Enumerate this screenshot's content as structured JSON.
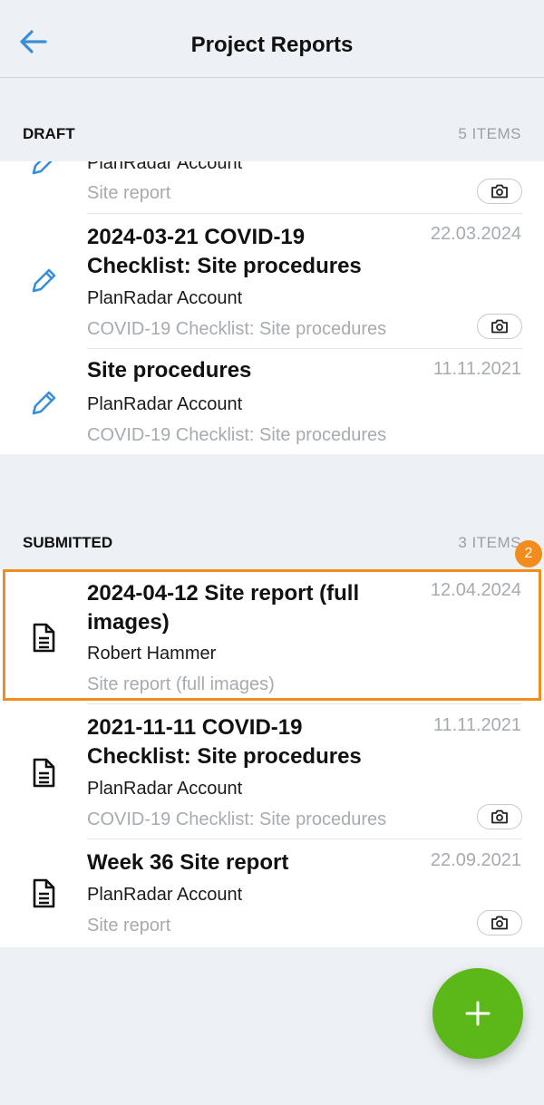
{
  "header": {
    "title": "Project Reports"
  },
  "draft": {
    "label": "DRAFT",
    "count": "5 ITEMS",
    "items": [
      {
        "title": "",
        "owner": "PlanRadar Account",
        "type": "Site report",
        "date": ""
      },
      {
        "title": "2024-03-21 COVID-19 Checklist: Site procedures",
        "owner": "PlanRadar Account",
        "type": "COVID-19 Checklist: Site procedures",
        "date": "22.03.2024"
      },
      {
        "title": "Site procedures",
        "owner": "PlanRadar Account",
        "type": "COVID-19 Checklist: Site procedures",
        "date": "11.11.2021"
      }
    ]
  },
  "submitted": {
    "label": "SUBMITTED",
    "count": "3 ITEMS",
    "items": [
      {
        "title": "2024-04-12 Site report (full images)",
        "owner": "Robert Hammer",
        "type": "Site report (full images)",
        "date": "12.04.2024"
      },
      {
        "title": "2021-11-11 COVID-19 Checklist: Site procedures",
        "owner": "PlanRadar Account",
        "type": "COVID-19 Checklist: Site procedures",
        "date": "11.11.2021"
      },
      {
        "title": "Week 36 Site report",
        "owner": "PlanRadar Account",
        "type": "Site report",
        "date": "22.09.2021"
      }
    ]
  },
  "annotation": {
    "badge": "2"
  },
  "icons": {
    "back": "arrow-left-icon",
    "edit": "pencil-icon",
    "doc": "document-icon",
    "camera": "camera-icon",
    "add": "plus-icon"
  },
  "colors": {
    "accent": "#3a8ed8",
    "highlight": "#f28c1d",
    "fab": "#5cb818"
  }
}
